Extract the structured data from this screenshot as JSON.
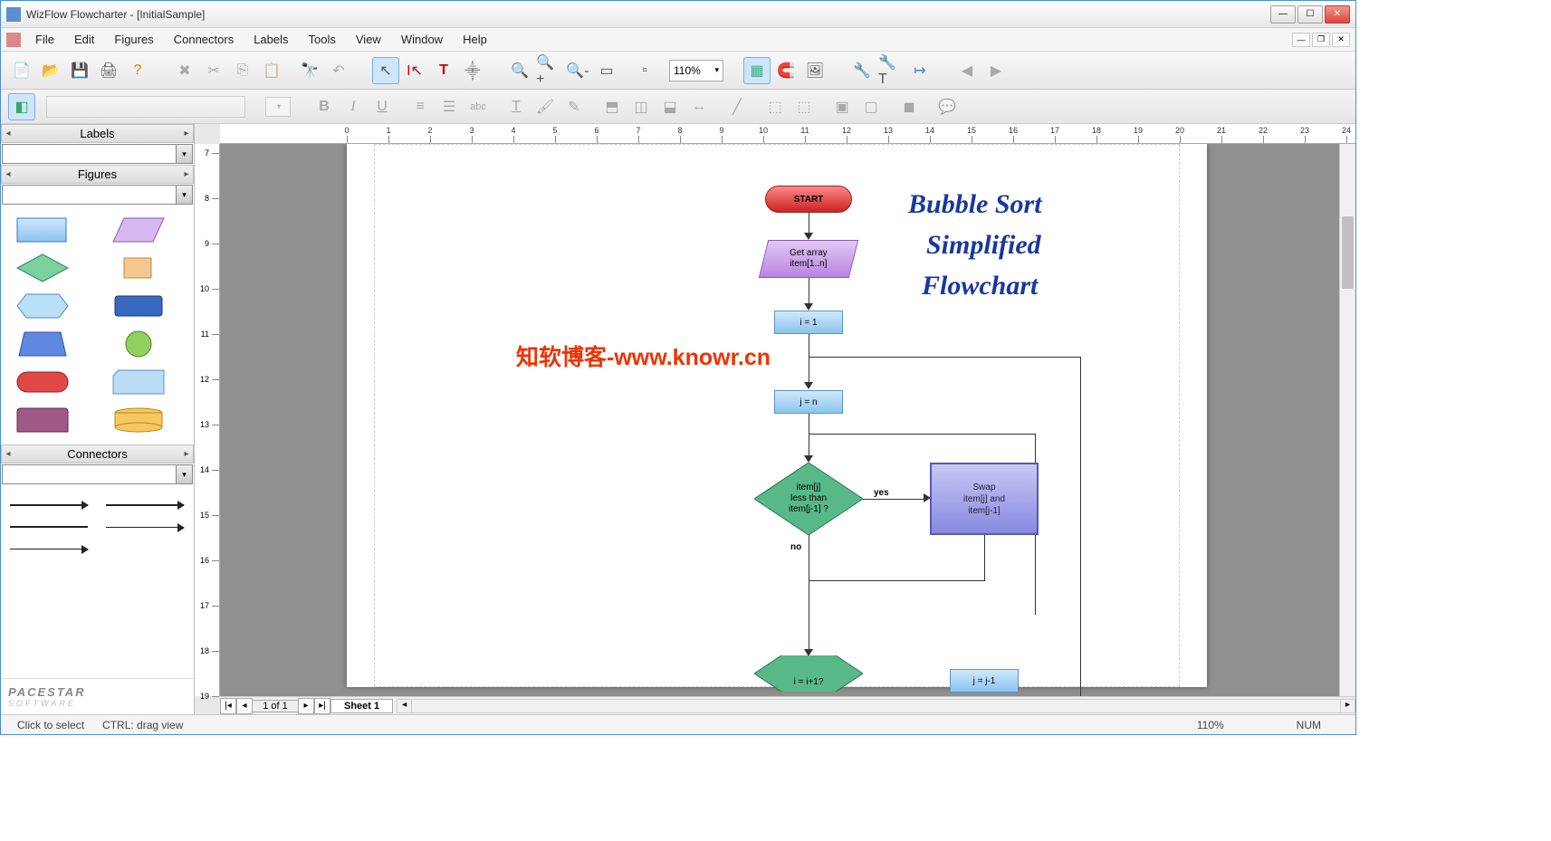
{
  "window": {
    "title": "WizFlow Flowcharter - [InitialSample]"
  },
  "menu": {
    "items": [
      "File",
      "Edit",
      "Figures",
      "Connectors",
      "Labels",
      "Tools",
      "View",
      "Window",
      "Help"
    ]
  },
  "toolbar": {
    "zoom": "110%"
  },
  "sidebar": {
    "labels_header": "Labels",
    "figures_header": "Figures",
    "connectors_header": "Connectors",
    "logo_line1": "PACESTAR",
    "logo_line2": "SOFTWARE"
  },
  "sheet": {
    "counter": "1 of 1",
    "tab": "Sheet 1"
  },
  "ruler_h": [
    "0",
    "1",
    "2",
    "3",
    "4",
    "5",
    "6",
    "7",
    "8",
    "9",
    "10",
    "11",
    "12",
    "13",
    "14",
    "15",
    "16",
    "17",
    "18",
    "19",
    "20",
    "21",
    "22",
    "23",
    "24"
  ],
  "ruler_v": [
    "7",
    "8",
    "9",
    "10",
    "11",
    "12",
    "13",
    "14",
    "15",
    "16",
    "17",
    "18",
    "19"
  ],
  "flowchart": {
    "start": "START",
    "getarray_l1": "Get array",
    "getarray_l2": "item[1..n]",
    "i1": "i = 1",
    "jn": "j = n",
    "dec_l1": "item[j]",
    "dec_l2": "less than",
    "dec_l3": "item[j-1] ?",
    "yes": "yes",
    "no": "no",
    "swap_l1": "Swap",
    "swap_l2": "item[j] and",
    "swap_l3": "item[j-1]",
    "bottom_dec": "i = i+1?",
    "bottom_proc": "j = j-1",
    "title_l1": "Bubble Sort",
    "title_l2": "Simplified",
    "title_l3": "Flowchart"
  },
  "watermark": "知软博客-www.knowr.cn",
  "status": {
    "hint": "Click to select",
    "hint2": "CTRL: drag view",
    "zoom": "110%",
    "num": "NUM"
  }
}
